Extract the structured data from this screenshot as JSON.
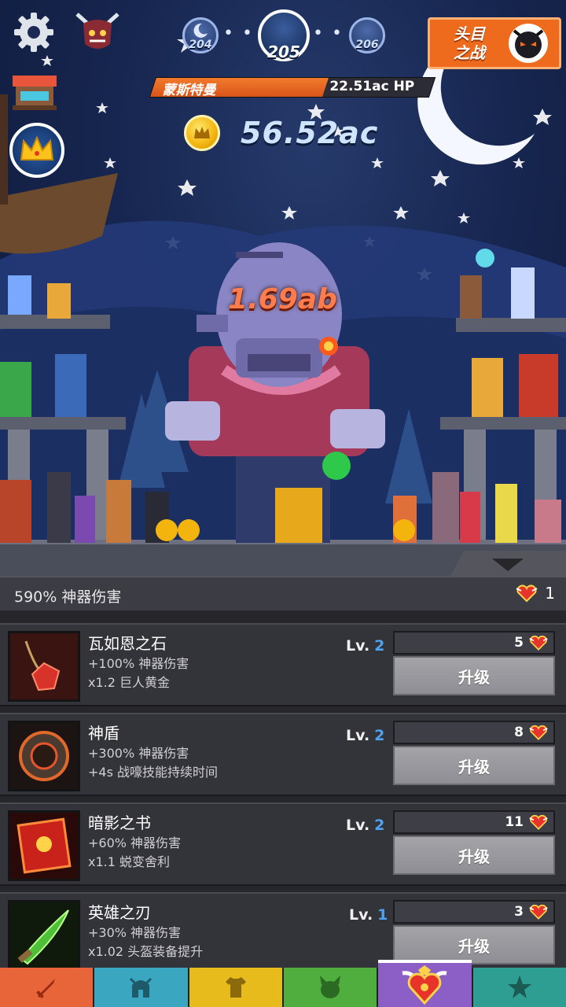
{
  "hud": {
    "stages": {
      "prev": "204",
      "current": "205",
      "next": "206"
    },
    "stage_dots": "• • •",
    "fight_boss_label": "头目\n之战",
    "boss_name": "蒙斯特曼",
    "boss_hp": "22.51ac HP",
    "boss_hp_fraction": 0.62,
    "gold_amount": "56.52ac",
    "damage_number": "1.69ab"
  },
  "strip": {
    "artifact_damage": "590% 神器伤害",
    "relic_count": "1"
  },
  "artifacts": [
    {
      "name": "瓦如恩之石",
      "line1": "+100% 神器伤害",
      "line2": "x1.2 巨人黄金",
      "lv_label": "Lv.",
      "lv": "2",
      "cost": "5",
      "button": "升级",
      "color": "#d8332a"
    },
    {
      "name": "神盾",
      "line1": "+300% 神器伤害",
      "line2": "+4s 战嚎技能持续时间",
      "lv_label": "Lv.",
      "lv": "2",
      "cost": "8",
      "button": "升级",
      "color": "#e0682a"
    },
    {
      "name": "暗影之书",
      "line1": "+60% 神器伤害",
      "line2": "x1.1 蜕变舍利",
      "lv_label": "Lv.",
      "lv": "2",
      "cost": "11",
      "button": "升级",
      "color": "#c8221a"
    },
    {
      "name": "英雄之刃",
      "line1": "+30% 神器伤害",
      "line2": "x1.02 头盔装备提升",
      "lv_label": "Lv.",
      "lv": "1",
      "cost": "3",
      "button": "升级",
      "color": "#4fbf3a"
    }
  ],
  "nav": [
    {
      "icon": "sword-icon"
    },
    {
      "icon": "helmet-icon"
    },
    {
      "icon": "shirt-icon"
    },
    {
      "icon": "pet-icon"
    },
    {
      "icon": "artifact-heart-icon",
      "active": true
    },
    {
      "icon": "star-icon"
    }
  ]
}
